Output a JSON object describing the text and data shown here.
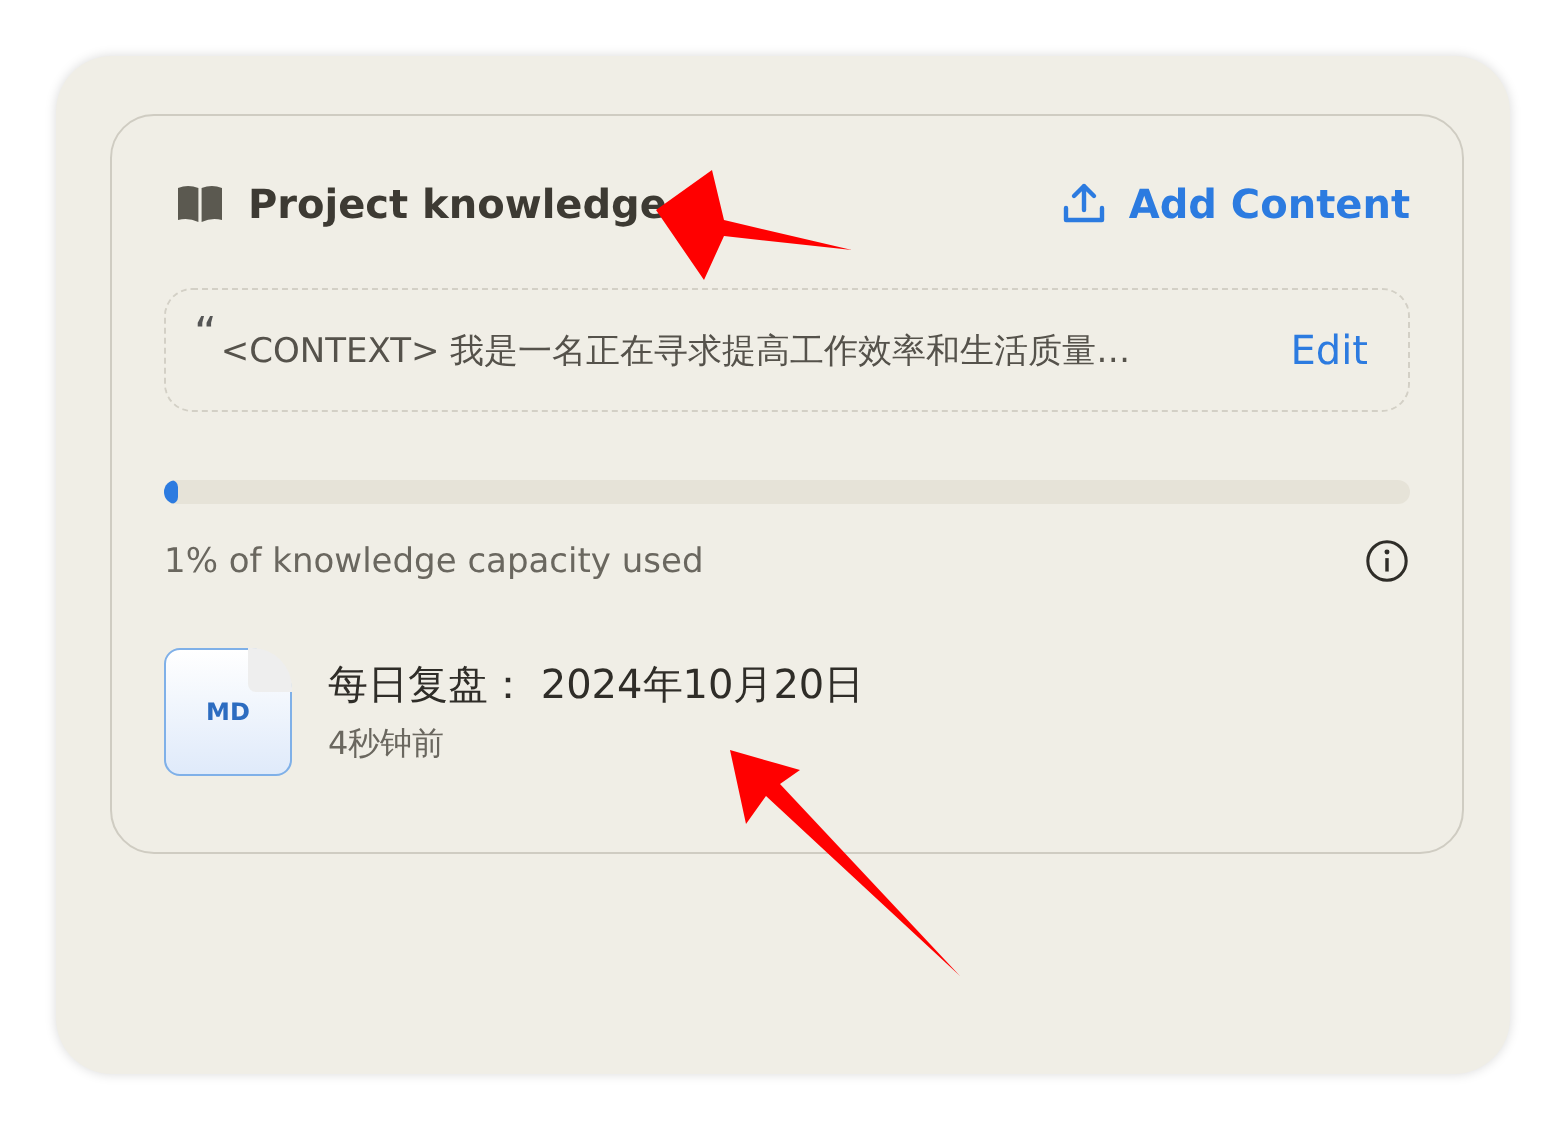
{
  "header": {
    "title": "Project knowledge",
    "add_button": "Add Content"
  },
  "instructions": {
    "quote_mark": "“",
    "text": "<CONTEXT> 我是一名正在寻求提高工作效率和生活质量…",
    "edit_link": "Edit"
  },
  "capacity": {
    "level": 0.01,
    "caption": "1% of knowledge capacity used"
  },
  "files": [
    {
      "badge": "MD",
      "name": "每日复盘： 2024年10月20日",
      "time": "4秒钟前"
    }
  ]
}
